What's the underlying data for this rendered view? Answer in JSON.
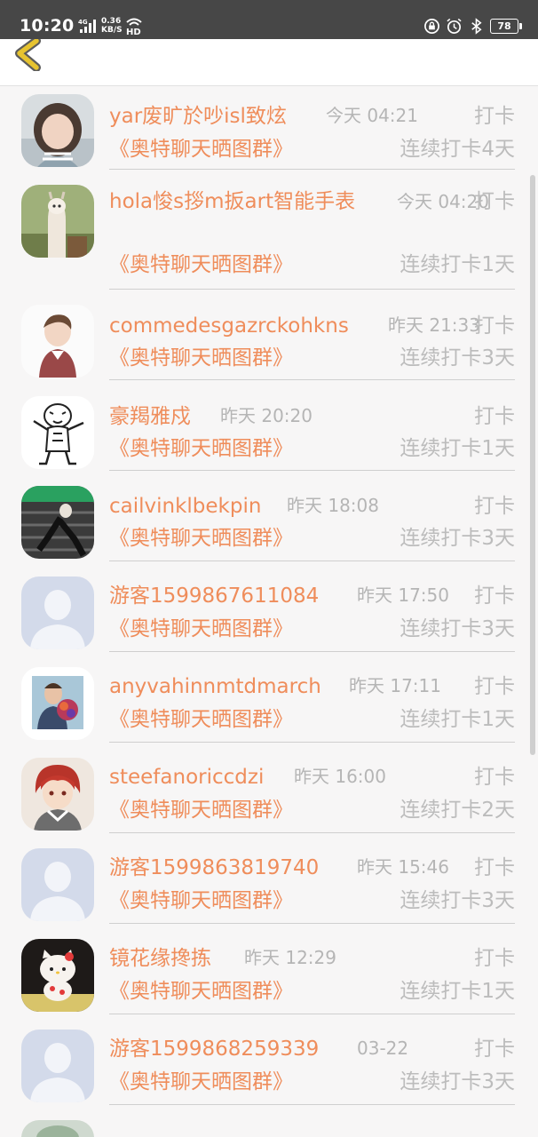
{
  "status_bar": {
    "time": "10:20",
    "network_label": "4G",
    "speed_value": "0.36",
    "speed_unit": "KB/S",
    "hd_label": "HD",
    "battery": "78"
  },
  "list": {
    "items": [
      {
        "name": "yar废旷於吵isl致炫",
        "time": "今天 04:21",
        "action": "打卡",
        "group": "《奥特聊天晒图群》",
        "streak": "连续打卡4天",
        "avatar": "girl-photo"
      },
      {
        "name": "hola悛s拶m扳art智能手表",
        "time": "今天 04:20",
        "action": "打卡",
        "group": "《奥特聊天晒图群》",
        "streak": "连续打卡1天",
        "avatar": "alpaca-photo"
      },
      {
        "name": "commedesgazrckohkns",
        "time": "昨天 21:33",
        "action": "打卡",
        "group": "《奥特聊天晒图群》",
        "streak": "连续打卡3天",
        "avatar": "cartoon-boy"
      },
      {
        "name": "豪羯雅戍",
        "time": "昨天 20:20",
        "action": "打卡",
        "group": "《奥特聊天晒图群》",
        "streak": "连续打卡1天",
        "avatar": "tiger-sketch"
      },
      {
        "name": "cailvinklbekpin",
        "time": "昨天 18:08",
        "action": "打卡",
        "group": "《奥特聊天晒图群》",
        "streak": "连续打卡3天",
        "avatar": "street-photo"
      },
      {
        "name": "游客1599867611084",
        "time": "昨天 17:50",
        "action": "打卡",
        "group": "《奥特聊天晒图群》",
        "streak": "连续打卡3天",
        "avatar": "default"
      },
      {
        "name": "anyvahinnmtdmarch",
        "time": "昨天 17:11",
        "action": "打卡",
        "group": "《奥特聊天晒图群》",
        "streak": "连续打卡1天",
        "avatar": "man-flowers"
      },
      {
        "name": "steefanoriccdzi",
        "time": "昨天 16:00",
        "action": "打卡",
        "group": "《奥特聊天晒图群》",
        "streak": "连续打卡2天",
        "avatar": "anime-redhair"
      },
      {
        "name": "游客1599863819740",
        "time": "昨天 15:46",
        "action": "打卡",
        "group": "《奥特聊天晒图群》",
        "streak": "连续打卡3天",
        "avatar": "default"
      },
      {
        "name": "镜花缘搀拣",
        "time": "昨天 12:29",
        "action": "打卡",
        "group": "《奥特聊天晒图群》",
        "streak": "连续打卡1天",
        "avatar": "hello-kitty"
      },
      {
        "name": "游客1599868259339",
        "time": "03-22",
        "action": "打卡",
        "group": "《奥特聊天晒图群》",
        "streak": "连续打卡3天",
        "avatar": "default"
      }
    ]
  },
  "icons": {
    "back": "back-arrow-icon",
    "avatar_default": "default-avatar-icon"
  },
  "colors": {
    "accent": "#ef8d5b",
    "muted_text": "#bcbcbc",
    "status_bar": "#474747",
    "back_arrow": "#e6c330",
    "background": "#f7f6f6"
  }
}
